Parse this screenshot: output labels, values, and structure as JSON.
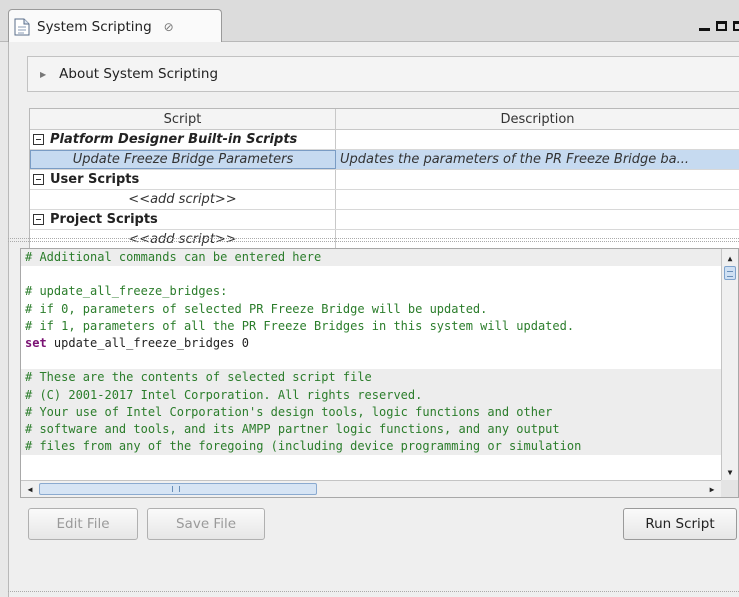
{
  "tab": {
    "title": "System Scripting",
    "close_glyph": "⊘"
  },
  "about": {
    "label": "About System Scripting"
  },
  "table": {
    "headers": [
      "Script",
      "Description"
    ],
    "groups": [
      {
        "name": "Platform Designer Built-in Scripts",
        "rows": [
          {
            "script": "Update Freeze Bridge Parameters",
            "description": "Updates the parameters of the PR Freeze Bridge ba...",
            "selected": true
          }
        ]
      },
      {
        "name": "User Scripts",
        "rows": [
          {
            "script": "<<add script>>",
            "description": ""
          }
        ]
      },
      {
        "name": "Project Scripts",
        "rows": [
          {
            "script": "<<add script>>",
            "description": ""
          }
        ]
      }
    ]
  },
  "editor": {
    "lines": [
      {
        "text": "# Additional commands can be entered here",
        "kind": "comment",
        "shade": true
      },
      {
        "text": "",
        "kind": "blank",
        "shade": false
      },
      {
        "text": "# update_all_freeze_bridges:",
        "kind": "comment",
        "shade": false
      },
      {
        "text": "# if 0, parameters of selected PR Freeze Bridge will be updated.",
        "kind": "comment",
        "shade": false
      },
      {
        "text": "# if 1, parameters of all the PR Freeze Bridges in this system will updated.",
        "kind": "comment",
        "shade": false
      },
      {
        "keyword": "set",
        "text": " update_all_freeze_bridges 0",
        "kind": "code",
        "shade": false
      },
      {
        "text": "",
        "kind": "blank",
        "shade": false
      },
      {
        "text": "# These are the contents of selected script file",
        "kind": "comment",
        "shade": true
      },
      {
        "text": "# (C) 2001-2017 Intel Corporation. All rights reserved.",
        "kind": "comment",
        "shade": true
      },
      {
        "text": "# Your use of Intel Corporation's design tools, logic functions and other",
        "kind": "comment",
        "shade": true
      },
      {
        "text": "# software and tools, and its AMPP partner logic functions, and any output",
        "kind": "comment",
        "shade": true
      },
      {
        "text": "# files from any of the foregoing (including device programming or simulation",
        "kind": "comment",
        "shade": true
      }
    ]
  },
  "buttons": {
    "edit_file": "Edit File",
    "save_file": "Save File",
    "run_script": "Run Script"
  },
  "colors": {
    "comment": "#2b7d2b",
    "keyword": "#7a1273",
    "selection": "#c6daf0"
  }
}
